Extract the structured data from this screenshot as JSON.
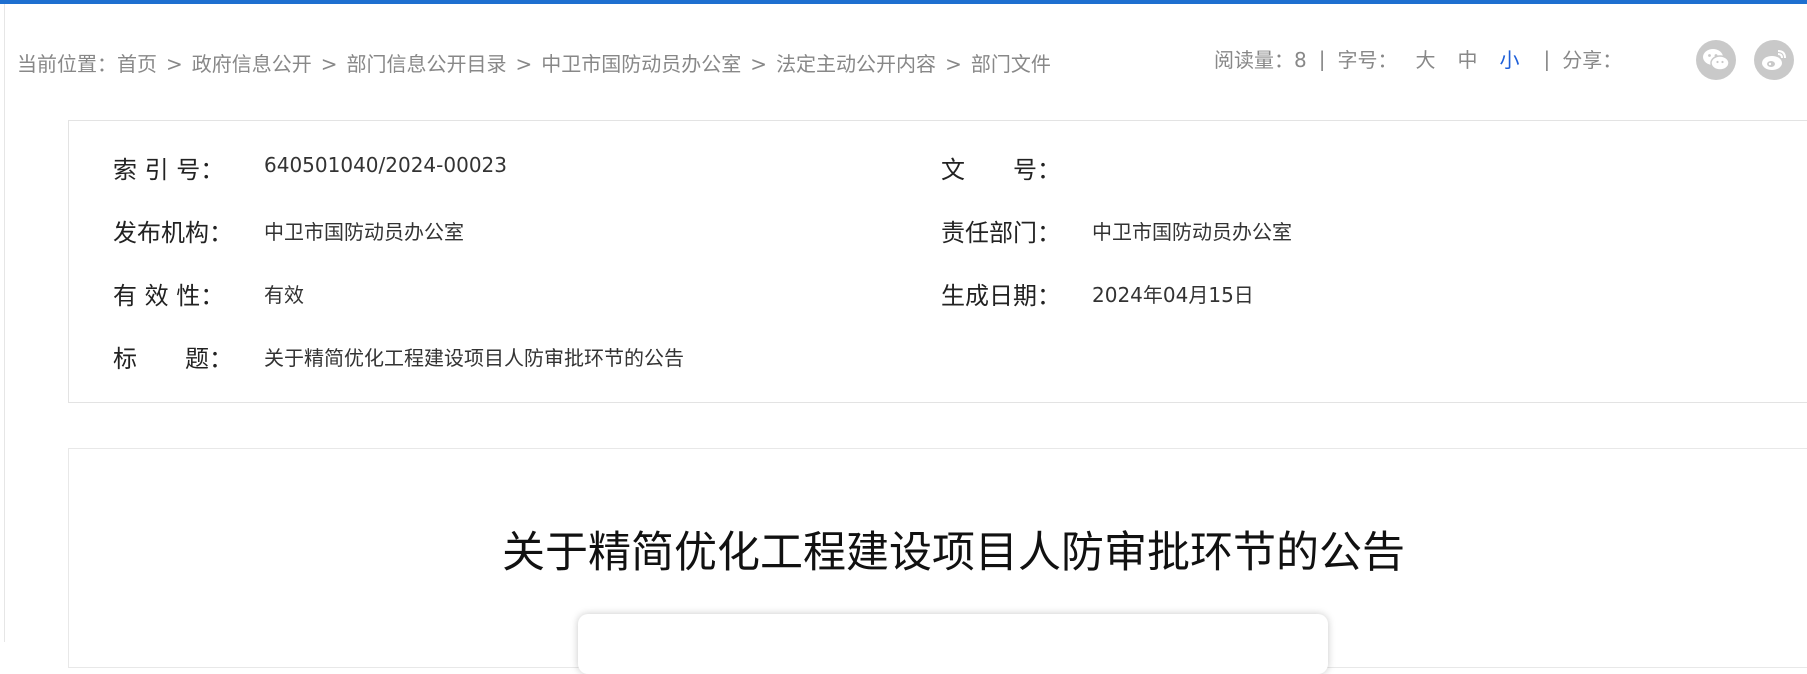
{
  "breadcrumb": {
    "prefix": "当前位置：",
    "items": [
      "首页",
      "政府信息公开",
      "部门信息公开目录",
      "中卫市国防动员办公室",
      "法定主动公开内容",
      "部门文件"
    ],
    "separator": ">"
  },
  "tools": {
    "read_label": "阅读量：8",
    "pipe": "|",
    "fontsize_label": "字号：",
    "fontsize_options": [
      "大",
      "中",
      "小"
    ],
    "active_fontsize": "小",
    "share_label": "分享：",
    "share_icons": [
      "wechat-icon",
      "weibo-icon"
    ]
  },
  "meta": {
    "index_label": "索 引 号：",
    "index_value": "640501040/2024-00023",
    "docno_label": "文　　号：",
    "docno_value": "",
    "publisher_label": "发布机构：",
    "publisher_value": "中卫市国防动员办公室",
    "dept_label": "责任部门：",
    "dept_value": "中卫市国防动员办公室",
    "validity_label": "有 效 性：",
    "validity_value": "有效",
    "date_label": "生成日期：",
    "date_value": "2024年04月15日",
    "title_label": "标　　题：",
    "title_value": "关于精简优化工程建设项目人防审批环节的公告"
  },
  "article": {
    "title": "关于精简优化工程建设项目人防审批环节的公告"
  },
  "colors": {
    "accent": "#1e6fd0",
    "active_link": "#1e5fd8",
    "icon_bg": "#c9c9c9"
  }
}
